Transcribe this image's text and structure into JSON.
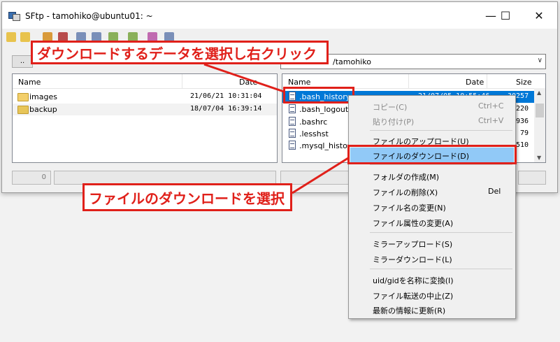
{
  "window": {
    "title": "SFtp - tamohiko@ubuntu01: ~",
    "controls": {
      "minimize": "—",
      "maximize": "☐",
      "close": "✕"
    }
  },
  "toolbar": {
    "icons": [
      "upload-icon",
      "download-icon",
      "new-folder-icon",
      "delete-icon",
      "copy-icon",
      "paste-icon",
      "refresh-icon",
      "up-icon",
      "settings-icon",
      "mirror-icon",
      "stop-icon",
      "info-icon"
    ]
  },
  "left_pane": {
    "up_button": "..",
    "columns": {
      "name": "Name",
      "date": "Date"
    },
    "rows": [
      {
        "name": "images",
        "date": "21/06/21 10:31:04"
      },
      {
        "name": "backup",
        "date": "18/07/04 16:39:14"
      }
    ],
    "status_zero": "0"
  },
  "right_pane": {
    "path": "/tamohiko",
    "columns": {
      "name": "Name",
      "date": "Date",
      "size": "Size"
    },
    "rows": [
      {
        "name": ".bash_history",
        "date": "21/07/05 10:55:46",
        "size": "30257"
      },
      {
        "name": ".bash_logout",
        "date": "",
        "size": "220"
      },
      {
        "name": ".bashrc",
        "date": "",
        "size": "3936"
      },
      {
        "name": ".lesshst",
        "date": "",
        "size": "79"
      },
      {
        "name": ".mysql_history",
        "date": "",
        "size": "1510"
      }
    ]
  },
  "context_menu": {
    "items": [
      {
        "label": "コピー(C)",
        "shortcut": "Ctrl+C",
        "disabled": true
      },
      {
        "label": "貼り付け(P)",
        "shortcut": "Ctrl+V",
        "disabled": true
      },
      {
        "label": "ファイルのアップロード(U)",
        "shortcut": ""
      },
      {
        "label": "ファイルのダウンロード(D)",
        "shortcut": ""
      },
      {
        "label": "フォルダの作成(M)",
        "shortcut": ""
      },
      {
        "label": "ファイルの削除(X)",
        "shortcut": "Del"
      },
      {
        "label": "ファイル名の変更(N)",
        "shortcut": ""
      },
      {
        "label": "ファイル属性の変更(A)",
        "shortcut": ""
      },
      {
        "label": "ミラーアップロード(S)",
        "shortcut": ""
      },
      {
        "label": "ミラーダウンロード(L)",
        "shortcut": ""
      },
      {
        "label": "uid/gidを名称に変換(I)",
        "shortcut": ""
      },
      {
        "label": "ファイル転送の中止(Z)",
        "shortcut": ""
      },
      {
        "label": "最新の情報に更新(R)",
        "shortcut": ""
      }
    ],
    "highlighted_index": 3
  },
  "annotations": {
    "callout_top": "ダウンロードするデータを選択し右クリック",
    "callout_bottom": "ファイルのダウンロードを選択"
  },
  "colors": {
    "annotation_red": "#e0201a",
    "selection_blue": "#0078d7",
    "menu_highlight": "#91c9f7"
  }
}
